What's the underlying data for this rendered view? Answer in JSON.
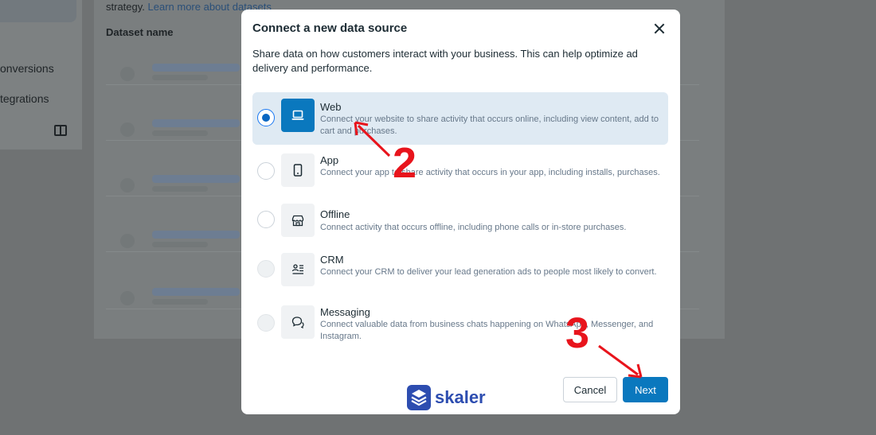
{
  "background": {
    "strategy_text": "strategy.",
    "learn_more_link": "Learn more about datasets",
    "column_header": "Dataset name",
    "nav_items": [
      "onversions",
      "tegrations"
    ]
  },
  "modal": {
    "title": "Connect a new data source",
    "description": "Share data on how customers interact with your business. This can help optimize ad delivery and performance.",
    "options": [
      {
        "title": "Web",
        "description": "Connect your website to share activity that occurs online, including view content, add to cart and purchases.",
        "selected": true,
        "icon": "laptop-icon"
      },
      {
        "title": "App",
        "description": "Connect your app to share activity that occurs in your app, including installs, purchases.",
        "selected": false,
        "icon": "phone-icon"
      },
      {
        "title": "Offline",
        "description": "Connect activity that occurs offline, including phone calls or in-store purchases.",
        "selected": false,
        "icon": "store-icon"
      },
      {
        "title": "CRM",
        "description": "Connect your CRM to deliver your lead generation ads to people most likely to convert.",
        "selected": false,
        "icon": "crm-icon"
      },
      {
        "title": "Messaging",
        "description": "Connect valuable data from business chats happening on WhatsApp, Messenger, and Instagram.",
        "selected": false,
        "icon": "chat-icon"
      }
    ],
    "cancel_label": "Cancel",
    "next_label": "Next"
  },
  "brand": {
    "name": "skaler"
  },
  "annotations": {
    "step2": "2",
    "step3": "3",
    "color": "#e8141c"
  },
  "colors": {
    "accent": "#0a78be",
    "selected_bg": "#dfeaf3"
  }
}
